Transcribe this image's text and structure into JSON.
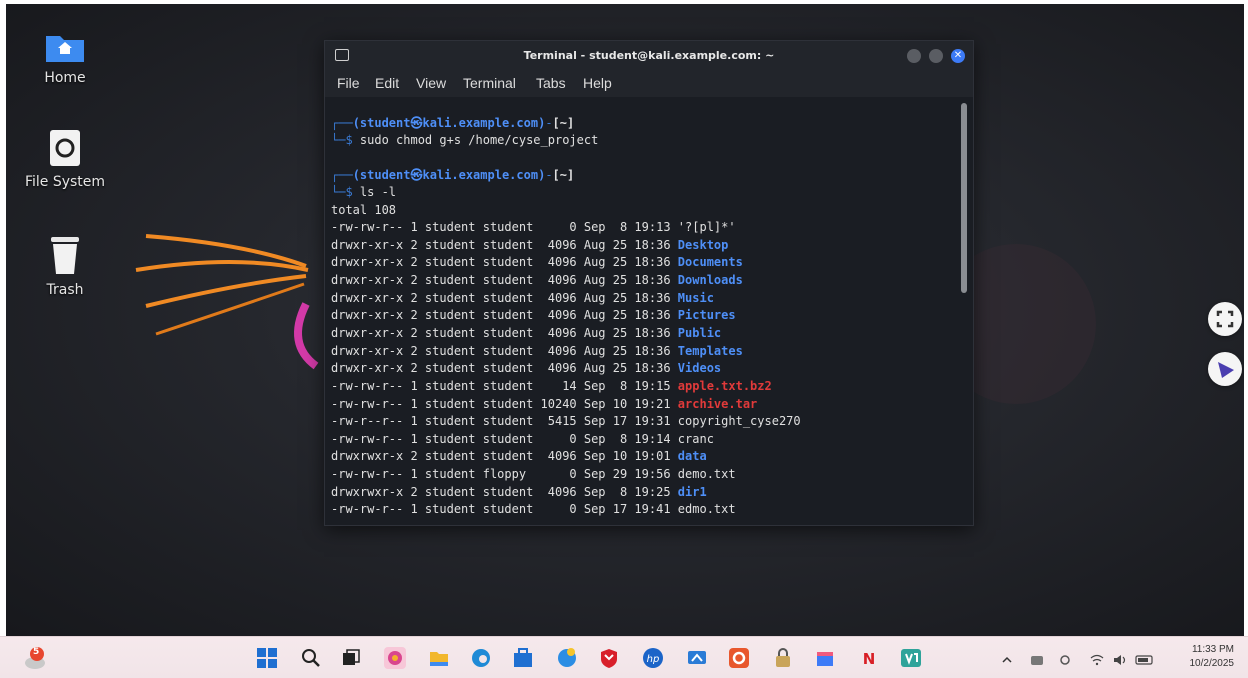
{
  "desktop": {
    "icons": [
      {
        "label": "Home"
      },
      {
        "label": "File System"
      },
      {
        "label": "Trash"
      }
    ]
  },
  "terminal": {
    "title": "Terminal - student@kali.example.com: ~",
    "menu": [
      "File",
      "Edit",
      "View",
      "Terminal",
      "Tabs",
      "Help"
    ],
    "prompt_user": "(student㉿kali.example.com)",
    "prompt_path": "[~]",
    "command1": "sudo chmod g+s /home/cyse_project",
    "command2": "ls -l",
    "total": "total 108",
    "listing": [
      {
        "meta": "-rw-rw-r-- 1 student student     0 Sep  8 19:13",
        "name": "'?[pl]*'",
        "kind": "plain"
      },
      {
        "meta": "drwxr-xr-x 2 student student  4096 Aug 25 18:36",
        "name": "Desktop",
        "kind": "dir"
      },
      {
        "meta": "drwxr-xr-x 2 student student  4096 Aug 25 18:36",
        "name": "Documents",
        "kind": "dir"
      },
      {
        "meta": "drwxr-xr-x 2 student student  4096 Aug 25 18:36",
        "name": "Downloads",
        "kind": "dir"
      },
      {
        "meta": "drwxr-xr-x 2 student student  4096 Aug 25 18:36",
        "name": "Music",
        "kind": "dir"
      },
      {
        "meta": "drwxr-xr-x 2 student student  4096 Aug 25 18:36",
        "name": "Pictures",
        "kind": "dir"
      },
      {
        "meta": "drwxr-xr-x 2 student student  4096 Aug 25 18:36",
        "name": "Public",
        "kind": "dir"
      },
      {
        "meta": "drwxr-xr-x 2 student student  4096 Aug 25 18:36",
        "name": "Templates",
        "kind": "dir"
      },
      {
        "meta": "drwxr-xr-x 2 student student  4096 Aug 25 18:36",
        "name": "Videos",
        "kind": "dir"
      },
      {
        "meta": "-rw-rw-r-- 1 student student    14 Sep  8 19:15",
        "name": "apple.txt.bz2",
        "kind": "archive"
      },
      {
        "meta": "-rw-rw-r-- 1 student student 10240 Sep 10 19:21",
        "name": "archive.tar",
        "kind": "archive"
      },
      {
        "meta": "-rw-r--r-- 1 student student  5415 Sep 17 19:31",
        "name": "copyright_cyse270",
        "kind": "plain"
      },
      {
        "meta": "-rw-rw-r-- 1 student student     0 Sep  8 19:14",
        "name": "cranc",
        "kind": "plain"
      },
      {
        "meta": "drwxrwxr-x 2 student student  4096 Sep 10 19:01",
        "name": "data",
        "kind": "dir"
      },
      {
        "meta": "-rw-rw-r-- 1 student floppy      0 Sep 29 19:56",
        "name": "demo.txt",
        "kind": "plain"
      },
      {
        "meta": "drwxrwxr-x 2 student student  4096 Sep  8 19:25",
        "name": "dir1",
        "kind": "dir"
      },
      {
        "meta": "-rw-rw-r-- 1 student student     0 Sep 17 19:41",
        "name": "edmo.txt",
        "kind": "plain"
      }
    ]
  },
  "taskbar": {
    "notification_count": "5",
    "clock_time": "11:33 PM",
    "clock_date": "10/2/2025",
    "pinned": [
      "windows-start",
      "search",
      "task-view",
      "copilot",
      "file-explorer",
      "edge",
      "microsoft-store",
      "google-chrome",
      "mcafee",
      "hp",
      "remote-desktop",
      "office",
      "security",
      "app-installer",
      "netflix",
      "visual-studio"
    ]
  },
  "colors": {
    "dir": "#4e8ff7",
    "archive": "#e13a3a",
    "accent": "#3d7bf7"
  }
}
